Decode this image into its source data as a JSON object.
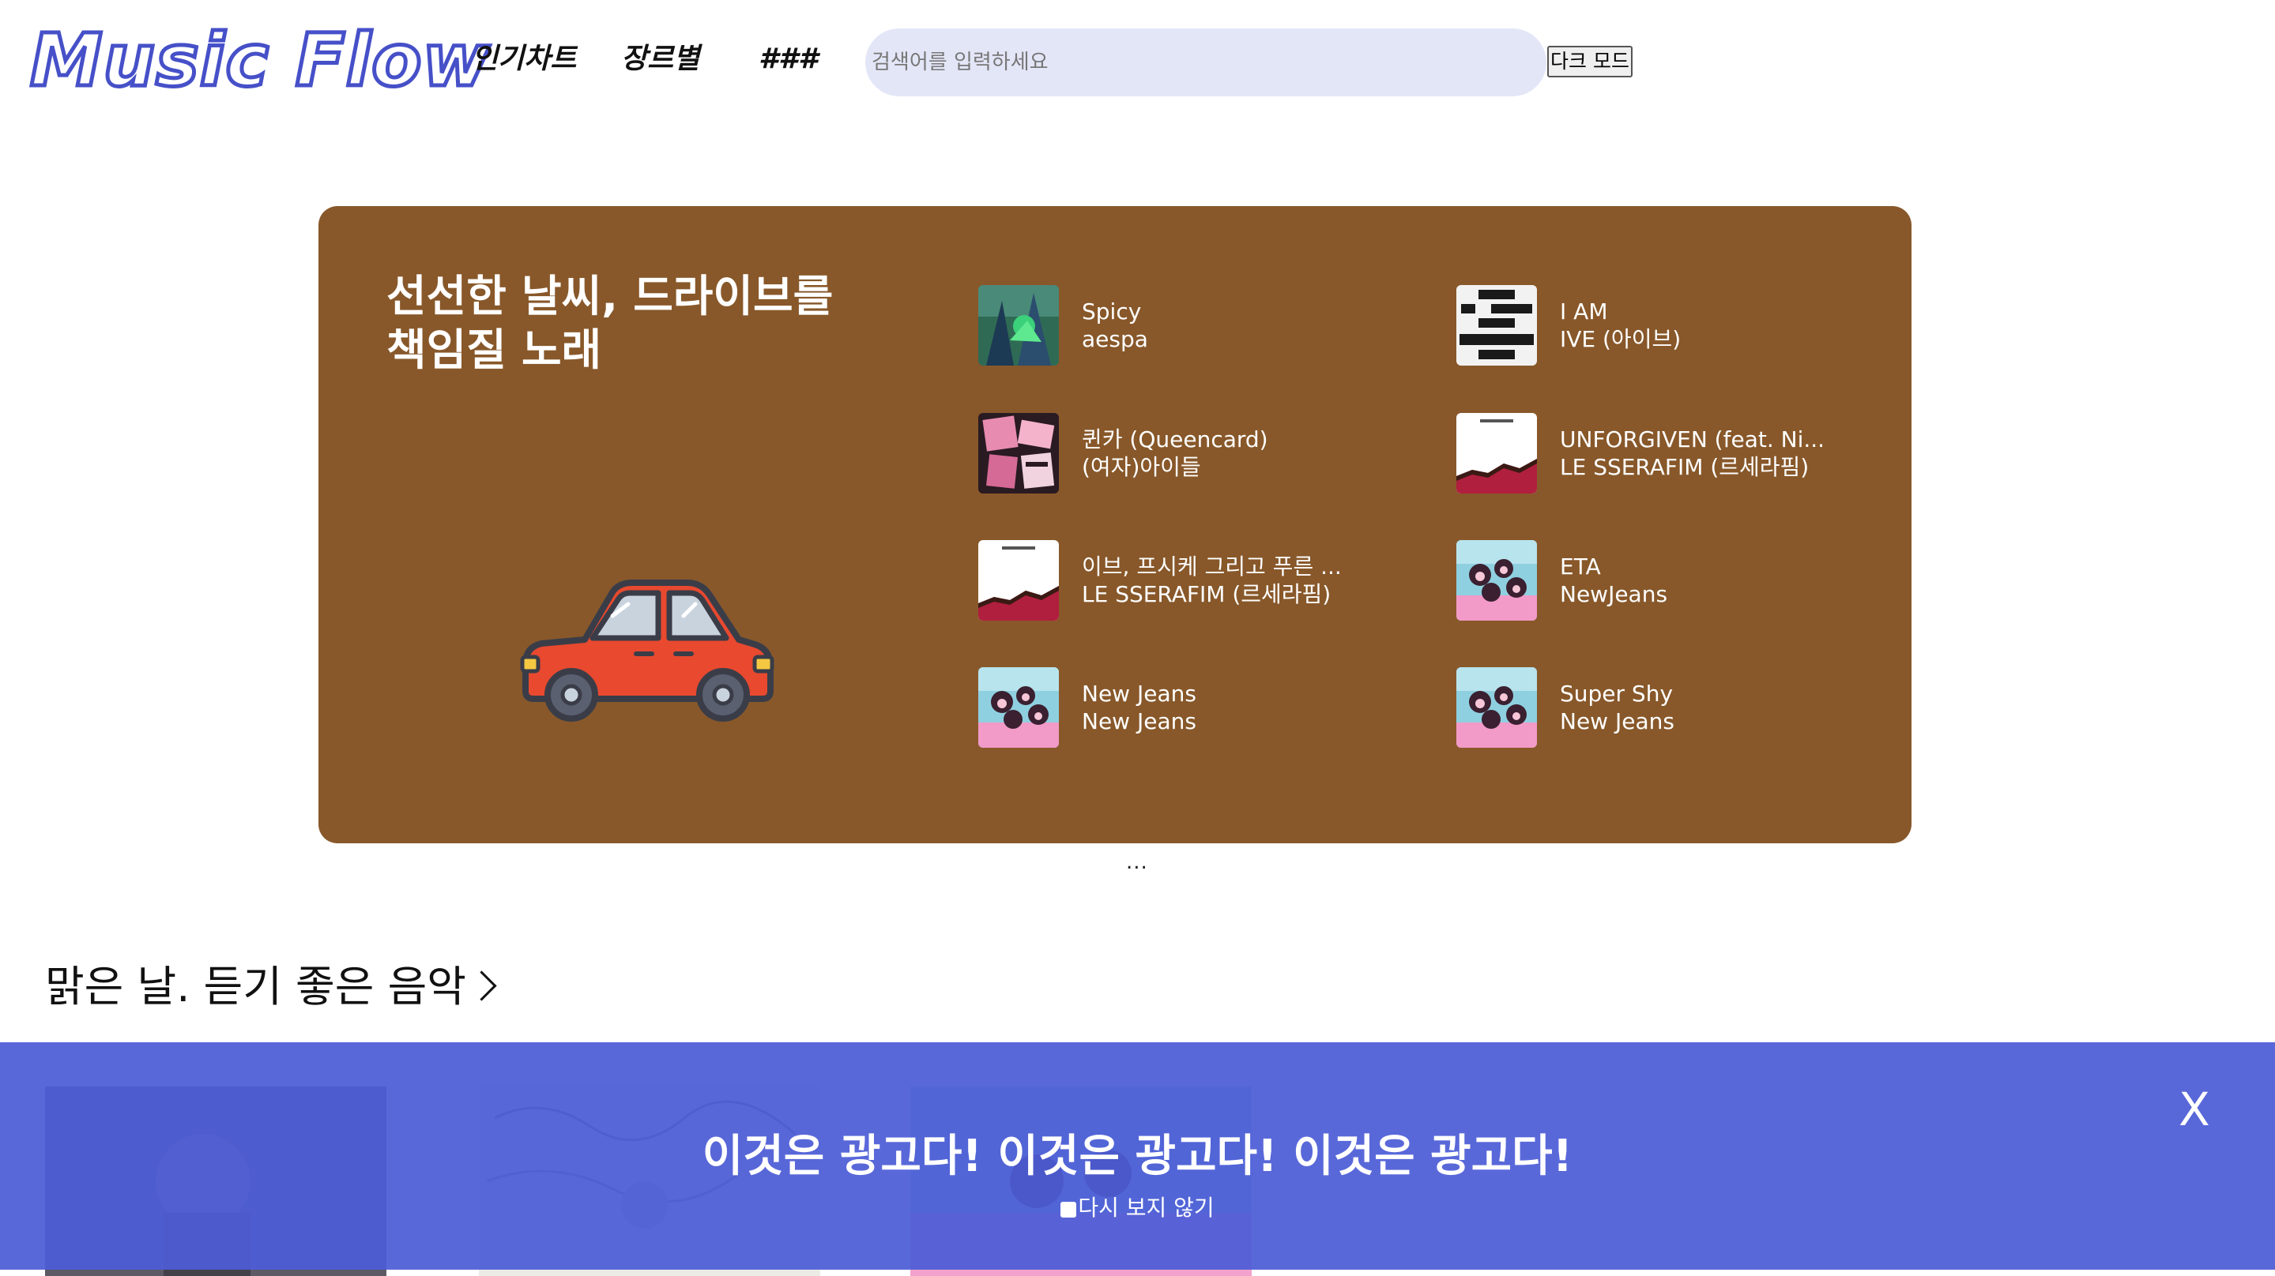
{
  "header": {
    "logo": "Music Flow",
    "nav": [
      "인기차트",
      "장르별",
      "###"
    ],
    "search_placeholder": "검색어를 입력하세요",
    "dark_mode_label": "다크 모드"
  },
  "banner": {
    "title": "선선한 날씨, 드라이브를 책임질 노래",
    "background_color": "#88582a",
    "songs": [
      {
        "title": "Spicy",
        "artist": "aespa"
      },
      {
        "title": "I AM",
        "artist": "IVE (아이브)"
      },
      {
        "title": "퀸카 (Queencard)",
        "artist": "(여자)아이들"
      },
      {
        "title": "UNFORGIVEN (feat. Ni...",
        "artist": "LE SSERAFIM (르세라핌)"
      },
      {
        "title": "이브, 프시케 그리고 푸른 ...",
        "artist": "LE SSERAFIM (르세라핌)"
      },
      {
        "title": "ETA",
        "artist": "NewJeans"
      },
      {
        "title": "New Jeans",
        "artist": "New Jeans"
      },
      {
        "title": "Super Shy",
        "artist": "New Jeans"
      }
    ],
    "pager": "..."
  },
  "section": {
    "title": "맑은 날. 듣기 좋은 음악"
  },
  "ad": {
    "text": "이것은 광고다! 이것은 광고다! 이것은 광고다!",
    "dont_show_label": "다시 보지 않기",
    "close_label": "X",
    "overlay_color": "#4c5cd6"
  }
}
